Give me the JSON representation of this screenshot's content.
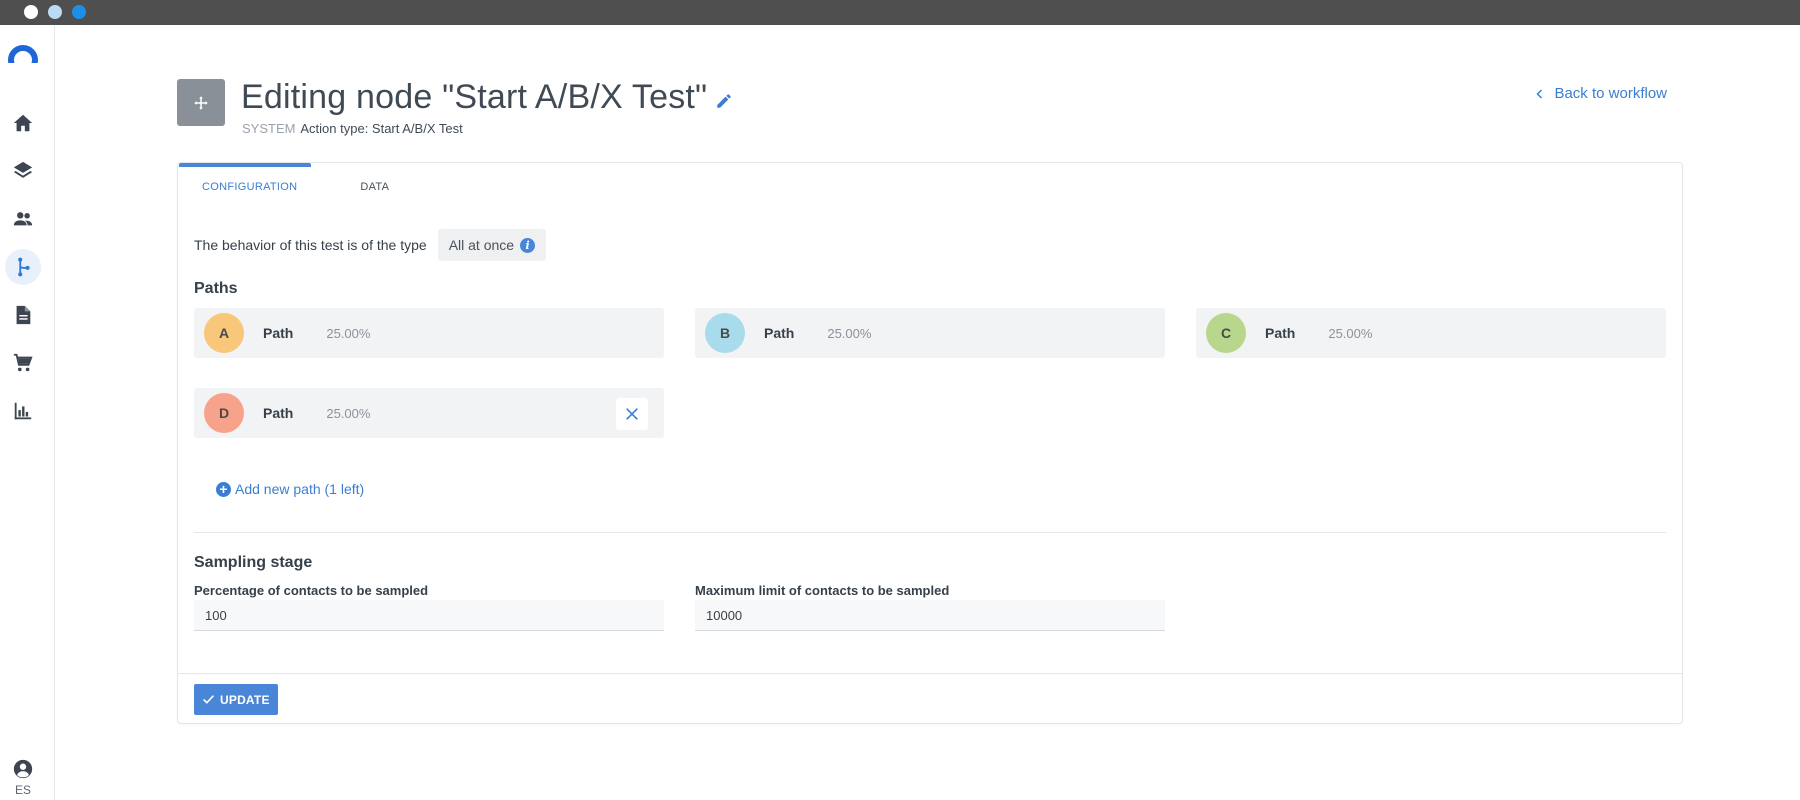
{
  "sidebar": {
    "items": [
      {
        "icon": "home-icon"
      },
      {
        "icon": "layers-icon"
      },
      {
        "icon": "people-icon"
      },
      {
        "icon": "workflow-icon",
        "active": true
      },
      {
        "icon": "document-icon"
      },
      {
        "icon": "cart-icon"
      },
      {
        "icon": "bar-chart-icon"
      }
    ],
    "user_icon": "account-circle-icon",
    "language": "ES"
  },
  "header": {
    "title": "Editing node \"Start A/B/X Test\"",
    "system_tag": "SYSTEM",
    "action_type": "Action type: Start A/B/X Test",
    "back_link": "Back to workflow"
  },
  "tabs": [
    {
      "label": "CONFIGURATION",
      "active": true
    },
    {
      "label": "DATA",
      "active": false
    }
  ],
  "behavior": {
    "label": "The behavior of this test is of the type",
    "value": "All at once"
  },
  "paths": {
    "title": "Paths",
    "items": [
      {
        "letter": "A",
        "label": "Path",
        "percent": "25.00%",
        "color": "#f9c77a"
      },
      {
        "letter": "B",
        "label": "Path",
        "percent": "25.00%",
        "color": "#a8dcec"
      },
      {
        "letter": "C",
        "label": "Path",
        "percent": "25.00%",
        "color": "#b9d78c"
      },
      {
        "letter": "D",
        "label": "Path",
        "percent": "25.00%",
        "color": "#f7a38c",
        "removable": true
      }
    ],
    "add_label": "Add new path (1 left)"
  },
  "sampling": {
    "title": "Sampling stage",
    "percentage_label": "Percentage of contacts to be sampled",
    "percentage_value": "100",
    "max_label": "Maximum limit of contacts to be sampled",
    "max_value": "10000"
  },
  "actions": {
    "update_label": "UPDATE"
  },
  "colors": {
    "accent": "#4a86d8",
    "link": "#3b7ed1"
  }
}
